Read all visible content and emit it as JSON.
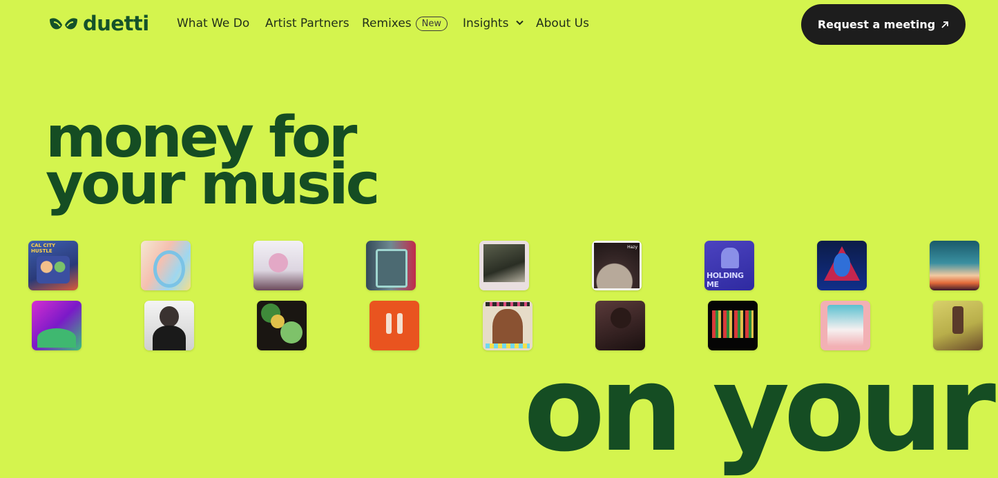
{
  "brand": {
    "name": "duetti"
  },
  "nav": {
    "items": [
      {
        "label": "What We Do"
      },
      {
        "label": "Artist Partners"
      },
      {
        "label": "Remixes",
        "badge": "New"
      },
      {
        "label": "Insights",
        "icon": "chevron-down-icon"
      },
      {
        "label": "About Us"
      }
    ],
    "cta": {
      "label": "Request a meeting",
      "icon": "arrow-up-right-icon"
    }
  },
  "hero": {
    "headline_line1": "money for",
    "headline_line2": "your music",
    "big_text": "on your"
  },
  "covers": {
    "row1": [
      {
        "text": "CAL CITY HUSTLE"
      },
      {
        "text": ""
      },
      {
        "text": ""
      },
      {
        "text": ""
      },
      {
        "text": ""
      },
      {
        "text": "Hazy"
      },
      {
        "text": "HOLDING ME"
      },
      {
        "text": ""
      },
      {
        "text": ""
      }
    ],
    "row2": [
      {
        "text": ""
      },
      {
        "text": ""
      },
      {
        "text": ""
      },
      {
        "text": ""
      },
      {
        "text": ""
      },
      {
        "text": ""
      },
      {
        "text": ""
      },
      {
        "text": ""
      },
      {
        "text": ""
      }
    ]
  },
  "colors": {
    "background": "#d4f44e",
    "brand_green": "#154d23",
    "cta_bg": "#1d1d1d"
  }
}
